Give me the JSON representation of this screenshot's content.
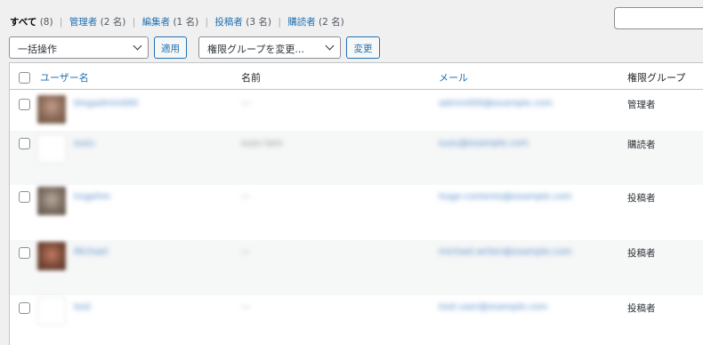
{
  "filters": [
    {
      "label": "すべて",
      "count": "(8)",
      "current": true
    },
    {
      "label": "管理者",
      "count": "(2 名)",
      "current": false
    },
    {
      "label": "編集者",
      "count": "(1 名)",
      "current": false
    },
    {
      "label": "投稿者",
      "count": "(3 名)",
      "current": false
    },
    {
      "label": "購読者",
      "count": "(2 名)",
      "current": false
    }
  ],
  "separator": "|",
  "search": {
    "value": ""
  },
  "bulk": {
    "selected": "一括操作",
    "apply_label": "適用"
  },
  "role_change": {
    "selected": "権限グループを変更...",
    "change_label": "変更"
  },
  "columns": {
    "username": "ユーザー名",
    "name": "名前",
    "email": "メール",
    "role": "権限グループ"
  },
  "rows": [
    {
      "username": "blogadmin000",
      "name": "—",
      "email": "admin000@example.com",
      "role": "管理者",
      "avatar": "photo"
    },
    {
      "username": "suzu",
      "name": "suzu taro",
      "email": "suzu@example.com",
      "role": "購読者",
      "avatar": "default"
    },
    {
      "username": "hogehm",
      "name": "—",
      "email": "hoge-contents@example.com",
      "role": "投稿者",
      "avatar": "photo2"
    },
    {
      "username": "Michael",
      "name": "—",
      "email": "michael.writer@example.com",
      "role": "投稿者",
      "avatar": "photo3"
    },
    {
      "username": "test",
      "name": "—",
      "email": "test-user@example.com",
      "role": "投稿者",
      "avatar": "default"
    }
  ]
}
